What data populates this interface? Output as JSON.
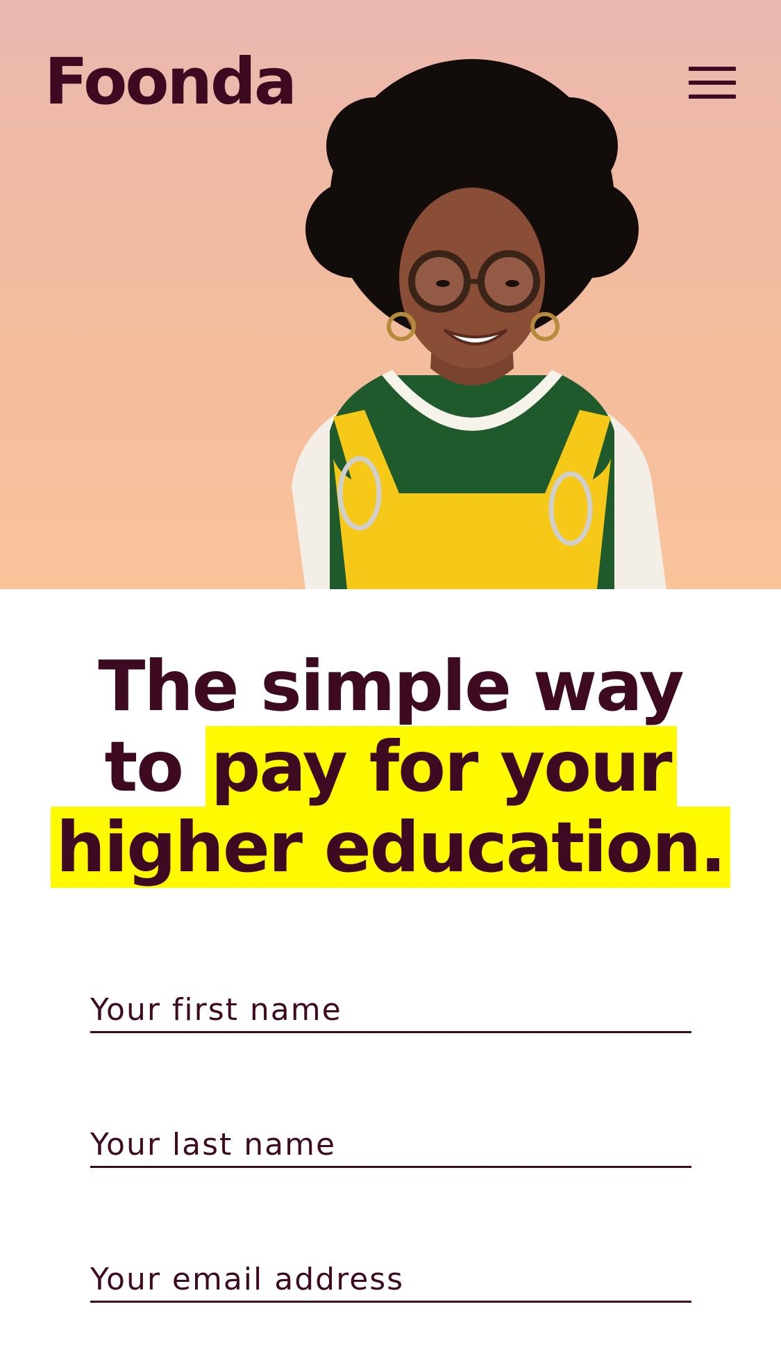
{
  "header": {
    "logo_text": "Foonda",
    "menu_icon": "hamburger-menu-icon"
  },
  "hero": {
    "image": "woman-with-glasses-portrait",
    "colors": {
      "background_top": "#ebb8b0",
      "background_bottom": "#f9c39a"
    }
  },
  "headline": {
    "line1": "The simple way",
    "line2_plain": "to ",
    "line2_highlight": "pay for your",
    "line3_highlight": "higher education."
  },
  "form": {
    "first_name": {
      "placeholder": "Your first name",
      "value": ""
    },
    "last_name": {
      "placeholder": "Your last name",
      "value": ""
    },
    "email": {
      "placeholder": "Your email address",
      "value": ""
    }
  },
  "colors": {
    "brand": "#3d0a22",
    "highlight": "#fffa00"
  }
}
